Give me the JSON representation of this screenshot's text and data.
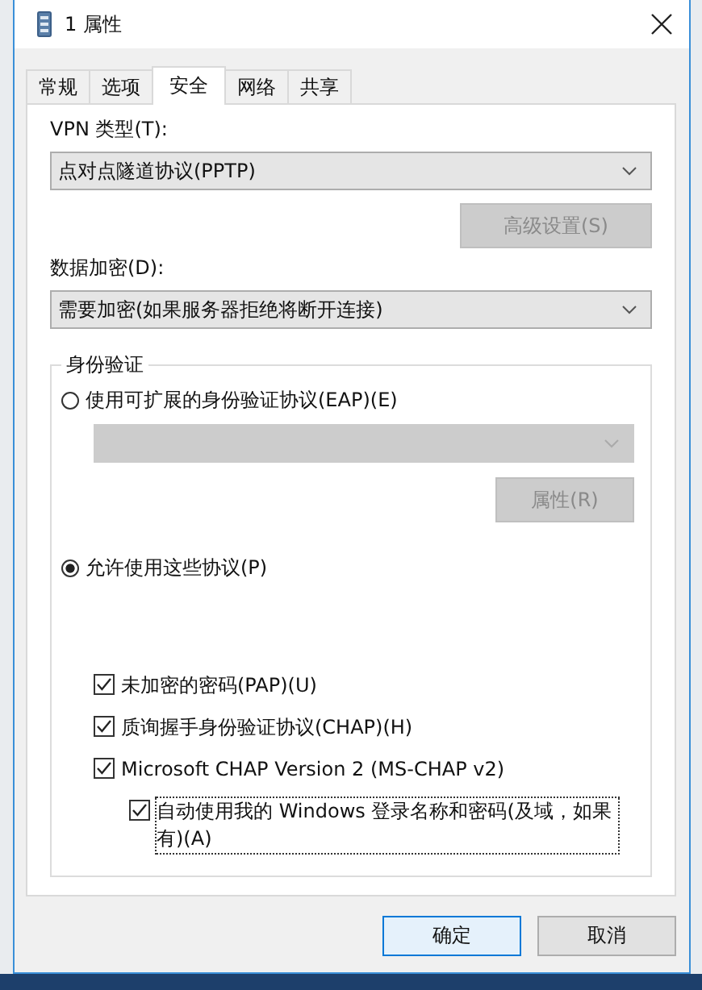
{
  "window": {
    "title": "1 属性"
  },
  "tabs": [
    {
      "label": "常规",
      "selected": false
    },
    {
      "label": "选项",
      "selected": false
    },
    {
      "label": "安全",
      "selected": true
    },
    {
      "label": "网络",
      "selected": false
    },
    {
      "label": "共享",
      "selected": false
    }
  ],
  "vpn_type": {
    "label": "VPN 类型(T):",
    "value": "点对点隧道协议(PPTP)"
  },
  "advanced_button": {
    "label": "高级设置(S)",
    "disabled": true
  },
  "encryption": {
    "label": "数据加密(D):",
    "value": "需要加密(如果服务器拒绝将断开连接)"
  },
  "authentication": {
    "title": "身份验证",
    "options": [
      {
        "label": "使用可扩展的身份验证协议(EAP)(E)",
        "selected": false
      },
      {
        "label": "允许使用这些协议(P)",
        "selected": true
      }
    ],
    "eap_dropdown": {
      "disabled": true
    },
    "properties_button": {
      "label": "属性(R)",
      "disabled": true
    },
    "protocols": [
      {
        "kind": "top",
        "label": "未加密的密码(PAP)(U)",
        "checked": true,
        "focused": false
      },
      {
        "kind": "top",
        "label": "质询握手身份验证协议(CHAP)(H)",
        "checked": true,
        "focused": false
      },
      {
        "kind": "top",
        "label": "Microsoft CHAP Version 2 (MS-CHAP v2)",
        "checked": true,
        "focused": false
      },
      {
        "kind": "nested",
        "label": "自动使用我的 Windows 登录名称和密码(及域，如果有)(A)",
        "checked": true,
        "focused": true
      }
    ]
  },
  "buttons": [
    {
      "label": "确定",
      "default": true
    },
    {
      "label": "取消",
      "default": false
    }
  ]
}
